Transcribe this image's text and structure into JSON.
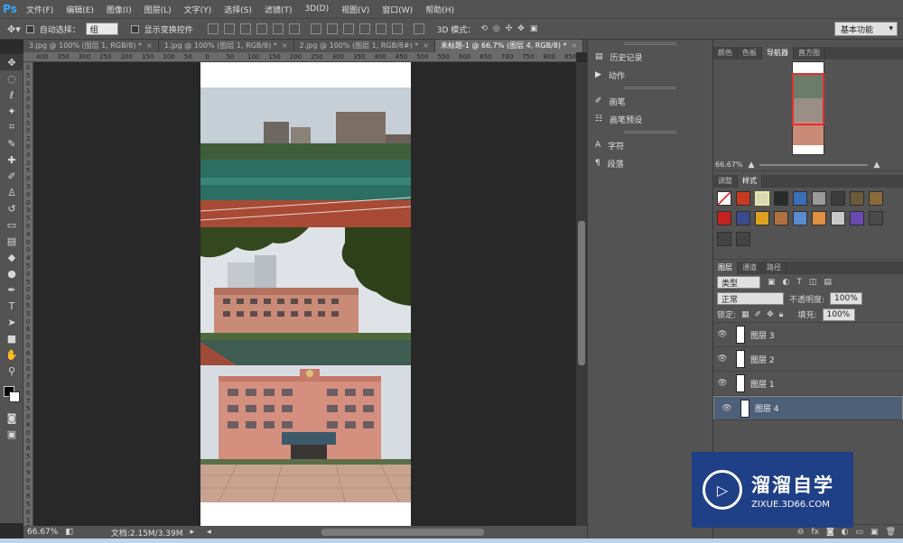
{
  "app": {
    "logo": "Ps"
  },
  "menu": [
    "文件(F)",
    "编辑(E)",
    "图像(I)",
    "图层(L)",
    "文字(Y)",
    "选择(S)",
    "滤镜(T)",
    "3D(D)",
    "视图(V)",
    "窗口(W)",
    "帮助(H)"
  ],
  "options": {
    "auto_select_label": "自动选择：",
    "auto_select_value": "组",
    "show_transform_label": "显示变换控件",
    "mode_3d_label": "3D 模式：",
    "workspace": "基本功能"
  },
  "tabs": [
    {
      "label": "3.jpg @ 100% (图层 1, RGB/8) *",
      "close": "×"
    },
    {
      "label": "1.jpg @ 100% (图层 1, RGB/8) *",
      "close": "×"
    },
    {
      "label": "2.jpg @ 100% (图层 1, RGB/8#) *",
      "close": "×"
    },
    {
      "label": "未标题-1 @ 66.7% (图层 4, RGB/8) *",
      "close": "×"
    }
  ],
  "ruler": {
    "h": [
      "400",
      "350",
      "300",
      "250",
      "200",
      "150",
      "100",
      "50",
      "0",
      "50",
      "100",
      "150",
      "200",
      "250",
      "300",
      "350",
      "400",
      "450",
      "500",
      "550",
      "600",
      "650",
      "700",
      "750",
      "800",
      "850"
    ],
    "v": [
      "0",
      "5",
      "0",
      "1",
      "0",
      "0",
      "1",
      "5",
      "0",
      "2",
      "0",
      "0",
      "2",
      "5",
      "0",
      "3",
      "0",
      "0",
      "3",
      "5",
      "0",
      "4",
      "0",
      "0",
      "4",
      "5",
      "0",
      "5",
      "0",
      "0",
      "5",
      "5",
      "0",
      "6",
      "0",
      "0",
      "6",
      "5",
      "0",
      "7",
      "0",
      "0",
      "7",
      "5",
      "0",
      "8",
      "0",
      "0",
      "8",
      "5",
      "0",
      "9",
      "0",
      "0",
      "9",
      "5",
      "0",
      "1",
      "0"
    ]
  },
  "status": {
    "zoom": "66.67%",
    "doc": "文档:2.15M/3.39M"
  },
  "mid_panel": {
    "items": [
      {
        "label": "历史记录",
        "icon": "history-icon"
      },
      {
        "label": "动作",
        "icon": "play-icon"
      },
      {
        "label": "画笔",
        "icon": "brush-icon"
      },
      {
        "label": "画笔预设",
        "icon": "brush-preset-icon"
      },
      {
        "label": "字符",
        "icon": "character-icon"
      },
      {
        "label": "段落",
        "icon": "paragraph-icon"
      }
    ]
  },
  "right": {
    "top_tabs": [
      "颜色",
      "色板",
      "导航器",
      "直方图"
    ],
    "nav_zoom": "66.67%",
    "style_tabs": [
      "调整",
      "样式"
    ],
    "layer_tabs": [
      "图层",
      "通道",
      "路径"
    ],
    "kind_label": "类型",
    "blend_mode": "正常",
    "opacity_label": "不透明度:",
    "opacity_value": "100%",
    "lock_label": "锁定:",
    "fill_label": "填充:",
    "fill_value": "100%",
    "layers": [
      {
        "name": "图层 3",
        "selected": false
      },
      {
        "name": "图层 2",
        "selected": false
      },
      {
        "name": "图层 1",
        "selected": false
      },
      {
        "name": "图层 4",
        "selected": true
      }
    ]
  },
  "watermark": {
    "title": "溜溜自学",
    "url": "ZIXUE.3D66.COM"
  }
}
